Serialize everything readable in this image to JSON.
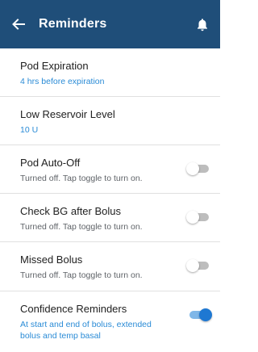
{
  "header": {
    "title": "Reminders",
    "back_icon": "arrow-left-icon",
    "bell_icon": "bell-icon",
    "background": "#1f4e79"
  },
  "reminders": [
    {
      "title": "Pod Expiration",
      "subtitle": "4 hrs before expiration",
      "subtitle_color": "blue",
      "has_toggle": false
    },
    {
      "title": "Low Reservoir Level",
      "subtitle": "10 U",
      "subtitle_color": "blue",
      "has_toggle": false
    },
    {
      "title": "Pod Auto-Off",
      "subtitle": "Turned off. Tap toggle to turn on.",
      "subtitle_color": "gray",
      "has_toggle": true,
      "toggle_on": false
    },
    {
      "title": "Check BG after Bolus",
      "subtitle": "Turned off. Tap toggle to turn on.",
      "subtitle_color": "gray",
      "has_toggle": true,
      "toggle_on": false
    },
    {
      "title": "Missed Bolus",
      "subtitle": "Turned off. Tap toggle to turn on.",
      "subtitle_color": "gray",
      "has_toggle": true,
      "toggle_on": false
    },
    {
      "title": "Confidence Reminders",
      "subtitle": "At start and end of bolus, extended bolus and temp basal",
      "subtitle_color": "blue",
      "has_toggle": true,
      "toggle_on": true
    }
  ],
  "colors": {
    "accent_blue": "#2a8bd6",
    "toggle_on": "#1e78d2",
    "toggle_off_track": "#bdbdbd"
  }
}
